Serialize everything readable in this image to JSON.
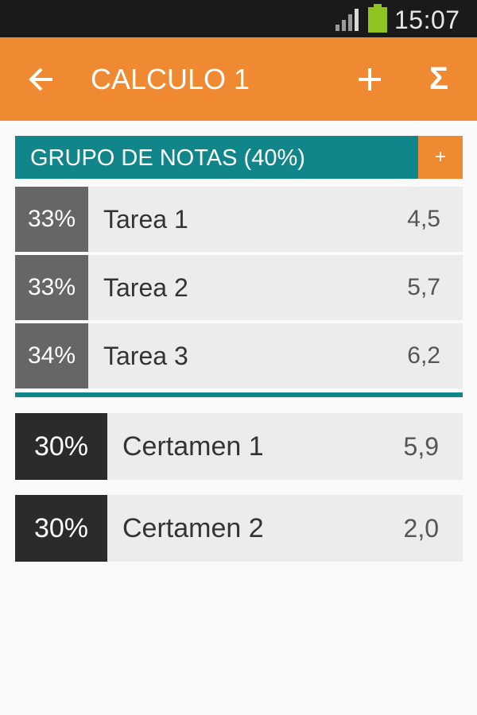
{
  "status_bar": {
    "time": "15:07",
    "signal_icon": "signal-bars-icon",
    "battery_icon": "battery-icon",
    "battery_color": "#8fc31f"
  },
  "app_bar": {
    "title": "CALCULO 1",
    "back_icon": "arrow-left-icon",
    "add_icon": "plus-icon",
    "sum_label": "Σ",
    "background": "#f08a32"
  },
  "group": {
    "title": "GRUPO DE NOTAS (40%)",
    "add_label": "+",
    "color": "#11868a",
    "items": [
      {
        "weight": "33%",
        "name": "Tarea 1",
        "grade": "4,5"
      },
      {
        "weight": "33%",
        "name": "Tarea 2",
        "grade": "5,7"
      },
      {
        "weight": "34%",
        "name": "Tarea 3",
        "grade": "6,2"
      }
    ]
  },
  "items": [
    {
      "weight": "30%",
      "name": "Certamen 1",
      "grade": "5,9"
    },
    {
      "weight": "30%",
      "name": "Certamen 2",
      "grade": "2,0"
    }
  ]
}
